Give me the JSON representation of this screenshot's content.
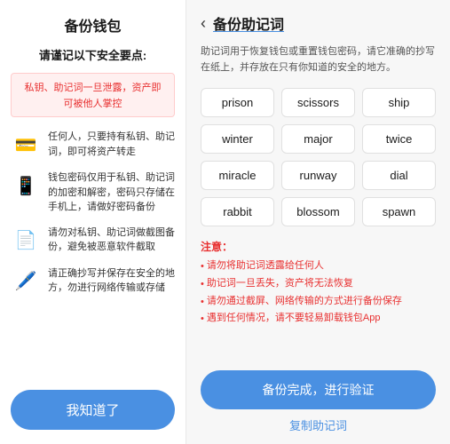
{
  "left": {
    "title": "备份钱包",
    "subtitle": "请谨记以下安全要点:",
    "warning": "私钥、助记词一旦泄露，资产即可被他人掌控",
    "items": [
      {
        "icon": "💳",
        "text": "任何人，只要持有私钥、助记词，即可将资产转走"
      },
      {
        "icon": "📱",
        "text": "钱包密码仅用于私钥、助记词的加密和解密，密码只存储在手机上，请做好密码备份"
      },
      {
        "icon": "📄",
        "text": "请勿对私钥、助记词做截图备份，避免被恶意软件截取"
      },
      {
        "icon": "🖊️",
        "text": "请正确抄写并保存在安全的地方，勿进行网络传输或存储"
      }
    ],
    "button": "我知道了"
  },
  "right": {
    "title": "备份助记词",
    "back_icon": "‹",
    "description": "助记词用于恢复钱包或重置钱包密码，请它准确的抄写在纸上，并存放在只有你知道的安全的地方。",
    "words": [
      "prison",
      "scissors",
      "ship",
      "winter",
      "major",
      "twice",
      "miracle",
      "runway",
      "dial",
      "rabbit",
      "blossom",
      "spawn"
    ],
    "notice_title": "注意：",
    "notices": [
      "请勿将助记词透露给任何人",
      "助记词一旦丢失，资产将无法恢复",
      "请勿通过截屏、网络传输的方式进行备份保存",
      "遇到任何情况，请不要轻易卸载钱包App"
    ],
    "verify_button": "备份完成，进行验证",
    "copy_button": "复制助记词"
  }
}
